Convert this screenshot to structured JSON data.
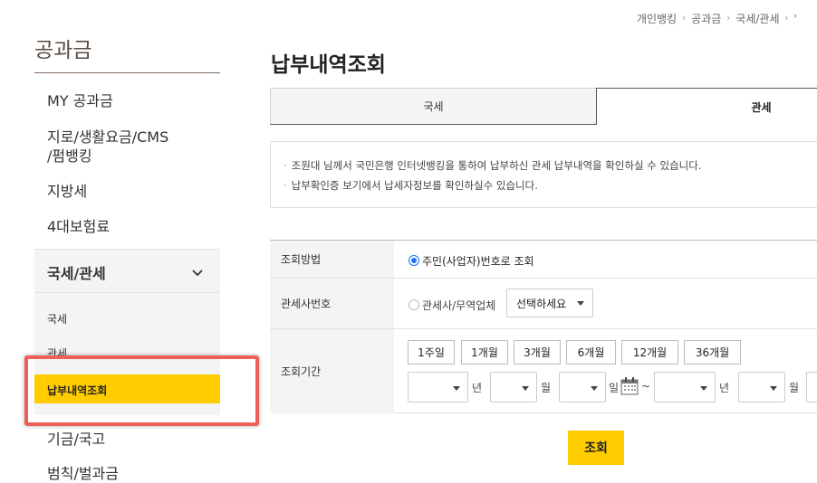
{
  "breadcrumb": [
    "개인뱅킹",
    "공과금",
    "국세/관세",
    "'"
  ],
  "sidebar": {
    "title": "공과금",
    "items": [
      "MY 공과금",
      "지로/생활요금/CMS",
      "/펌뱅킹",
      "지방세",
      "4대보험료"
    ],
    "group_label": "국세/관세",
    "sub_items": [
      "국세",
      "관세",
      "납부내역조회"
    ],
    "items_after": [
      "기금/국고",
      "범칙/벌과금"
    ]
  },
  "main": {
    "title": "납부내역조회",
    "tabs": [
      "국세",
      "관세"
    ],
    "notices": [
      "조원대 님께서 국민은행 인터넷뱅킹을 통하여 납부하신 관세 납부내역을 확인하실 수 있습니다.",
      "납부확인증 보기에서 납세자정보를 확인하실수 있습니다."
    ],
    "form": {
      "method_label": "조회방법",
      "method_option": "주민(사업자)번호로 조회",
      "customs_label": "관세사번호",
      "customs_option": "관세사/무역업체",
      "customs_select": "선택하세요",
      "period_label": "조회기간",
      "periods": [
        "1주일",
        "1개월",
        "3개월",
        "6개월",
        "12개월",
        "36개월"
      ],
      "date_units": [
        "년",
        "월",
        "일",
        "년",
        "월"
      ],
      "range_sep": "~"
    },
    "search_button": "조회"
  },
  "colors": {
    "accent": "#ffcc00",
    "radio": "#1b73e8",
    "highlight": "#ee5f57"
  }
}
